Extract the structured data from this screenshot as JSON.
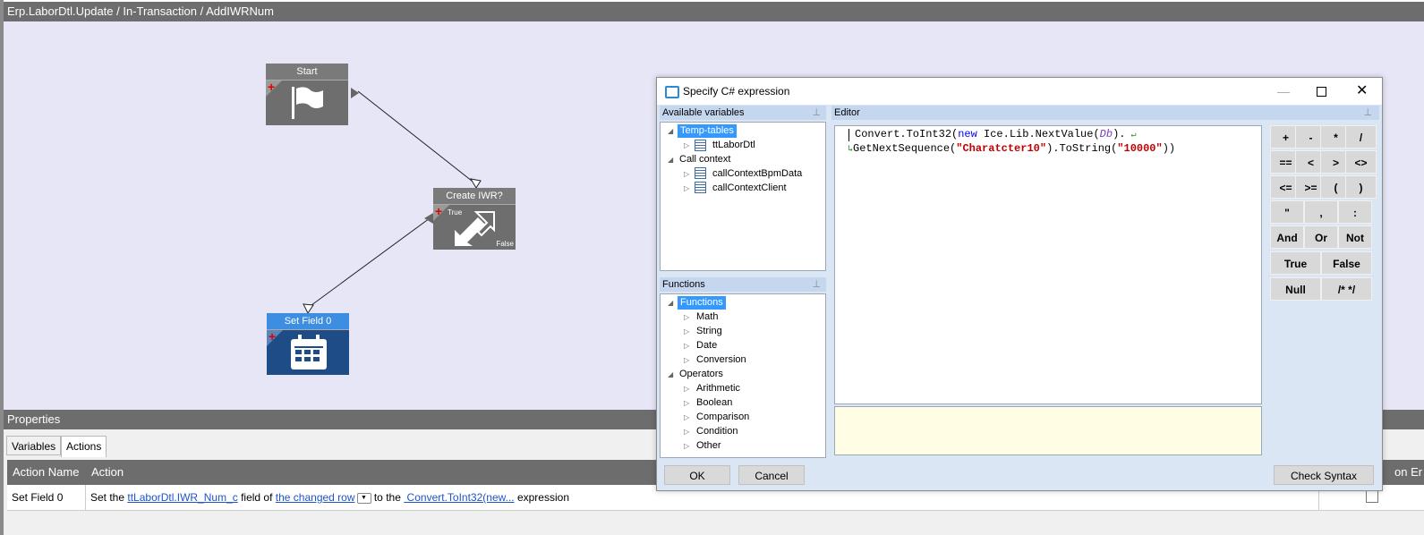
{
  "workflow": {
    "title": "Erp.LaborDtl.Update / In-Transaction / AddIWRNum",
    "nodes": {
      "start": "Start",
      "create": "Create IWR?",
      "create_true": "True",
      "create_false": "False",
      "set_field": "Set Field 0"
    }
  },
  "properties": {
    "title": "Properties",
    "tabs": [
      "Variables",
      "Actions"
    ],
    "columns": {
      "action_name": "Action Name",
      "action": "Action",
      "truncated": "on Er"
    },
    "row": {
      "name": "Set Field 0",
      "parts": [
        "Set the ",
        "ttLaborDtl.IWR_Num_c",
        " field of ",
        "the changed row",
        " to the ",
        " Convert.ToInt32(new...",
        " expression"
      ]
    }
  },
  "dialog": {
    "title": "Specify C# expression",
    "variables_header": "Available variables",
    "editor_header": "Editor",
    "functions_header": "Functions",
    "variables_tree": [
      "Temp-tables",
      "ttLaborDtl",
      "Call context",
      "callContextBpmData",
      "callContextClient"
    ],
    "functions_tree": [
      "Functions",
      "Math",
      "String",
      "Date",
      "Conversion",
      "Operators",
      "Arithmetic",
      "Boolean",
      "Comparison",
      "Condition",
      "Other"
    ],
    "code": {
      "l1_a": "Convert.ToInt32(",
      "l1_kw": "new",
      "l1_b": " Ice.Lib.NextValue(",
      "l1_db": "Db",
      "l1_c": ").",
      "l2_a": "GetNextSequence(",
      "l2_s1": "\"Charatcter10\"",
      "l2_b": ").ToString(",
      "l2_s2": "\"10000\"",
      "l2_c": "))"
    },
    "calc_buttons": [
      "+",
      "-",
      "*",
      "/",
      "==",
      "<",
      ">",
      "<>",
      "<=",
      ">=",
      "(",
      ")",
      "\"",
      ",",
      ":",
      "And",
      "Or",
      "Not",
      "True",
      "False",
      "Null",
      "/* */"
    ],
    "ok": "OK",
    "cancel": "Cancel",
    "check_syntax": "Check Syntax"
  },
  "colors": {
    "canvas": "#e6e6f7",
    "header_gray": "#6d6d6d",
    "set_field_blue": "#1d4c86",
    "selection": "#3399ff",
    "link": "#1f55c6"
  }
}
